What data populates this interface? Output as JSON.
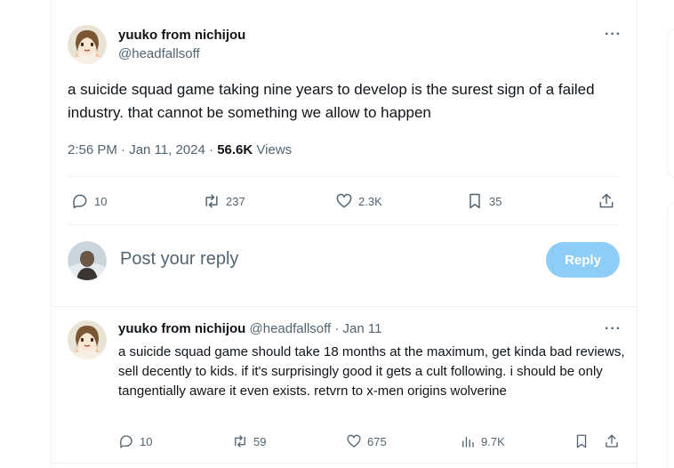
{
  "main_tweet": {
    "author_name": "yuuko from nichijou",
    "author_handle": "@headfallsoff",
    "text": "a suicide squad game taking nine years to develop is the surest sign of a failed industry. that cannot be something we allow to happen",
    "time": "2:56 PM",
    "date": "Jan 11, 2024",
    "separator": "·",
    "views_count": "56.6K",
    "views_label": "Views",
    "actions": {
      "replies": "10",
      "retweets": "237",
      "likes": "2.3K",
      "bookmarks": "35"
    },
    "more_label": "···"
  },
  "composer": {
    "placeholder": "Post your reply",
    "reply_button": "Reply"
  },
  "reply_tweet": {
    "author_name": "yuuko from nichijou",
    "author_handle": "@headfallsoff",
    "separator": "·",
    "date": "Jan 11",
    "text": "a suicide squad game should take 18 months at the maximum, get kinda bad reviews, sell decently to kids. if it's surprisingly good it gets a cult following. i should be only tangentially aware it even exists. retvrn to x-men origins wolverine",
    "more_label": "···",
    "actions": {
      "replies": "10",
      "retweets": "59",
      "likes": "675",
      "views": "9.7K"
    }
  },
  "colors": {
    "accent": "#1d9bf0",
    "reply_button_disabled": "#8ecdf7",
    "secondary_text": "#536471",
    "divider": "#eff3f4"
  },
  "icons": [
    "reply-icon",
    "retweet-icon",
    "like-icon",
    "bookmark-icon",
    "share-icon",
    "views-icon",
    "more-icon"
  ]
}
